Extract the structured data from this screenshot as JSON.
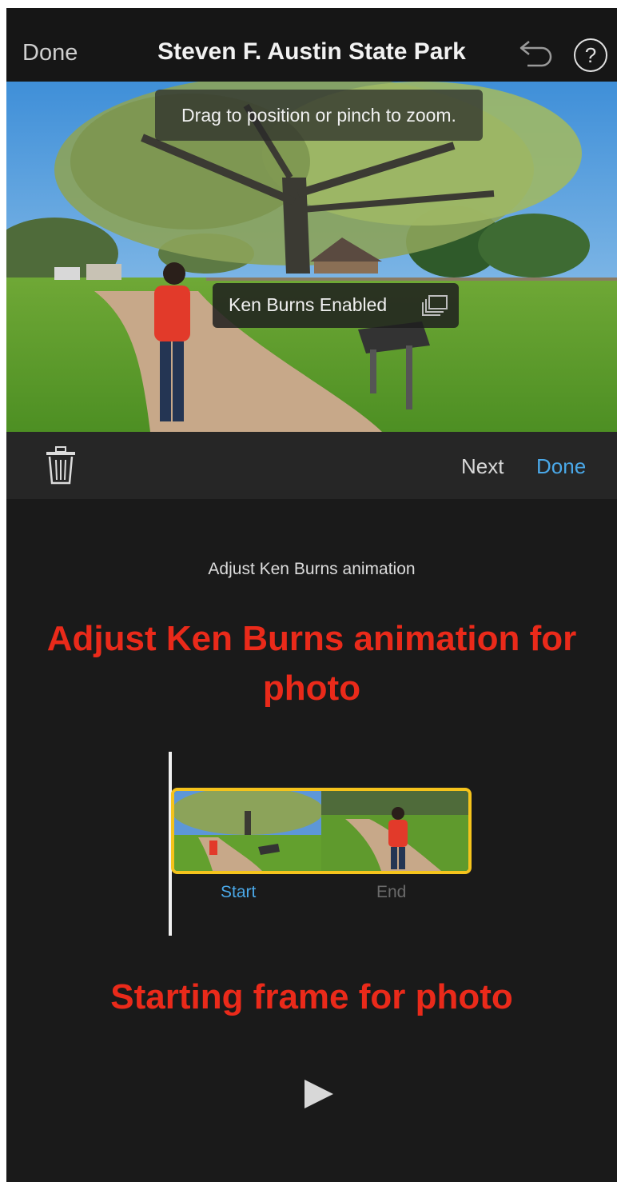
{
  "nav": {
    "done_label": "Done",
    "title": "Steven F. Austin State Park"
  },
  "viewer": {
    "hint": "Drag to position or pinch to zoom.",
    "ken_burns_label": "Ken Burns Enabled"
  },
  "toolbar": {
    "next_label": "Next",
    "done_label": "Done"
  },
  "panel": {
    "label": "Adjust Ken Burns animation",
    "annotation_top": "Adjust Ken Burns animation for photo",
    "start_label": "Start",
    "end_label": "End",
    "annotation_bottom": "Starting frame for photo"
  },
  "colors": {
    "accent_blue": "#4aa8e8",
    "annotation_red": "#ea2a1a",
    "selection_yellow": "#f5c31c"
  },
  "icons": {
    "undo": "undo-icon",
    "help": "help-icon",
    "photo_stack": "photo-stack-icon",
    "trash": "trash-icon",
    "play": "play-icon"
  }
}
